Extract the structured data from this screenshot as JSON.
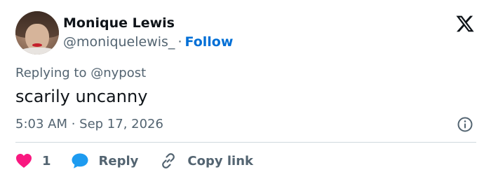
{
  "author": {
    "name": "Monique Lewis",
    "handle": "@moniquelewis_",
    "separator": "·",
    "follow_label": "Follow"
  },
  "reply_context": {
    "prefix": "Replying to",
    "mention": "@nypost"
  },
  "tweet": {
    "text": "scarily uncanny",
    "timestamp": "5:03 AM · Sep 17, 2026"
  },
  "actions": {
    "like_count": "1",
    "reply_label": "Reply",
    "copy_link_label": "Copy link"
  },
  "icons": {
    "brand": "x-logo-icon",
    "info": "info-icon",
    "like": "heart-icon",
    "reply": "chat-bubble-icon",
    "copy": "link-icon"
  },
  "colors": {
    "follow": "#006fd6",
    "heart": "#f91880",
    "reply_bubble": "#1d9bf0",
    "muted_text": "#536471",
    "primary_text": "#0f1419"
  }
}
